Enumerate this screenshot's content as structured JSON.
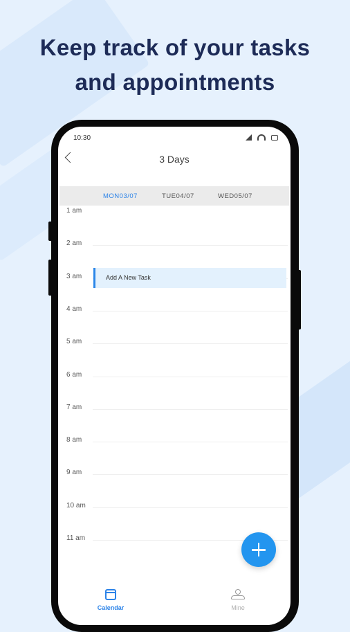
{
  "headline": {
    "line1": "Keep track of your tasks",
    "line2": "and appointments"
  },
  "status": {
    "time": "10:30"
  },
  "topbar": {
    "title": "3 Days"
  },
  "days": [
    {
      "label": "MON03/07",
      "active": true
    },
    {
      "label": "TUE04/07",
      "active": false
    },
    {
      "label": "WED05/07",
      "active": false
    }
  ],
  "hours": [
    "1 am",
    "2 am",
    "3 am",
    "4 am",
    "5 am",
    "6 am",
    "7 am",
    "8 am",
    "9 am",
    "10 am",
    "11 am"
  ],
  "task": {
    "label": "Add A New Task"
  },
  "nav": {
    "calendar": "Calendar",
    "mine": "Mine"
  },
  "colors": {
    "accent": "#2c83e8",
    "fab": "#2395ef",
    "headline": "#1d2b57"
  }
}
